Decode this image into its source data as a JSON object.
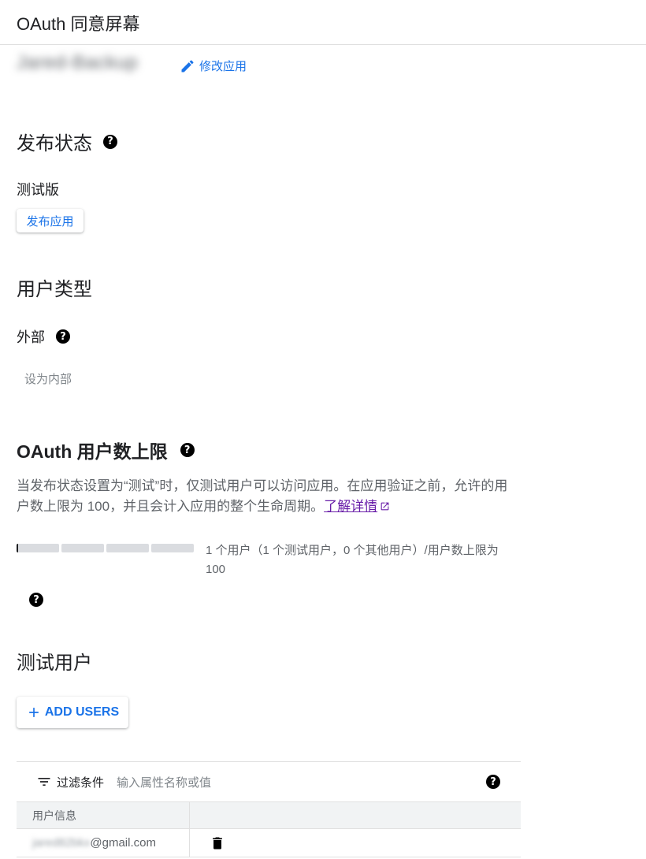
{
  "header": {
    "title": "OAuth 同意屏幕"
  },
  "app": {
    "name": "Jared-Backup",
    "edit_label": "修改应用"
  },
  "publish": {
    "title": "发布状态",
    "status": "测试版",
    "publish_button": "发布应用"
  },
  "user_type": {
    "title": "用户类型",
    "value": "外部",
    "make_internal": "设为内部"
  },
  "user_cap": {
    "title": "OAuth 用户数上限",
    "description": "当发布状态设置为“测试”时，仅测试用户可以访问应用。在应用验证之前，允许的用户数上限为 100，并且会计入应用的整个生命周期。",
    "learn_more": "了解详情",
    "usage_text": "1 个用户（1 个测试用户，0 个其他用户）/用户数上限为 100",
    "usage_fraction": 0.01
  },
  "test_users": {
    "title": "测试用户",
    "add_button": "ADD USERS",
    "filter_label": "过滤条件",
    "filter_placeholder": "输入属性名称或值",
    "column_user_info": "用户信息",
    "rows": [
      {
        "email_local": "jared82bkx",
        "email_domain": "@gmail.com"
      }
    ]
  },
  "colors": {
    "accent": "#1a73e8",
    "link_visited": "#681da8"
  }
}
